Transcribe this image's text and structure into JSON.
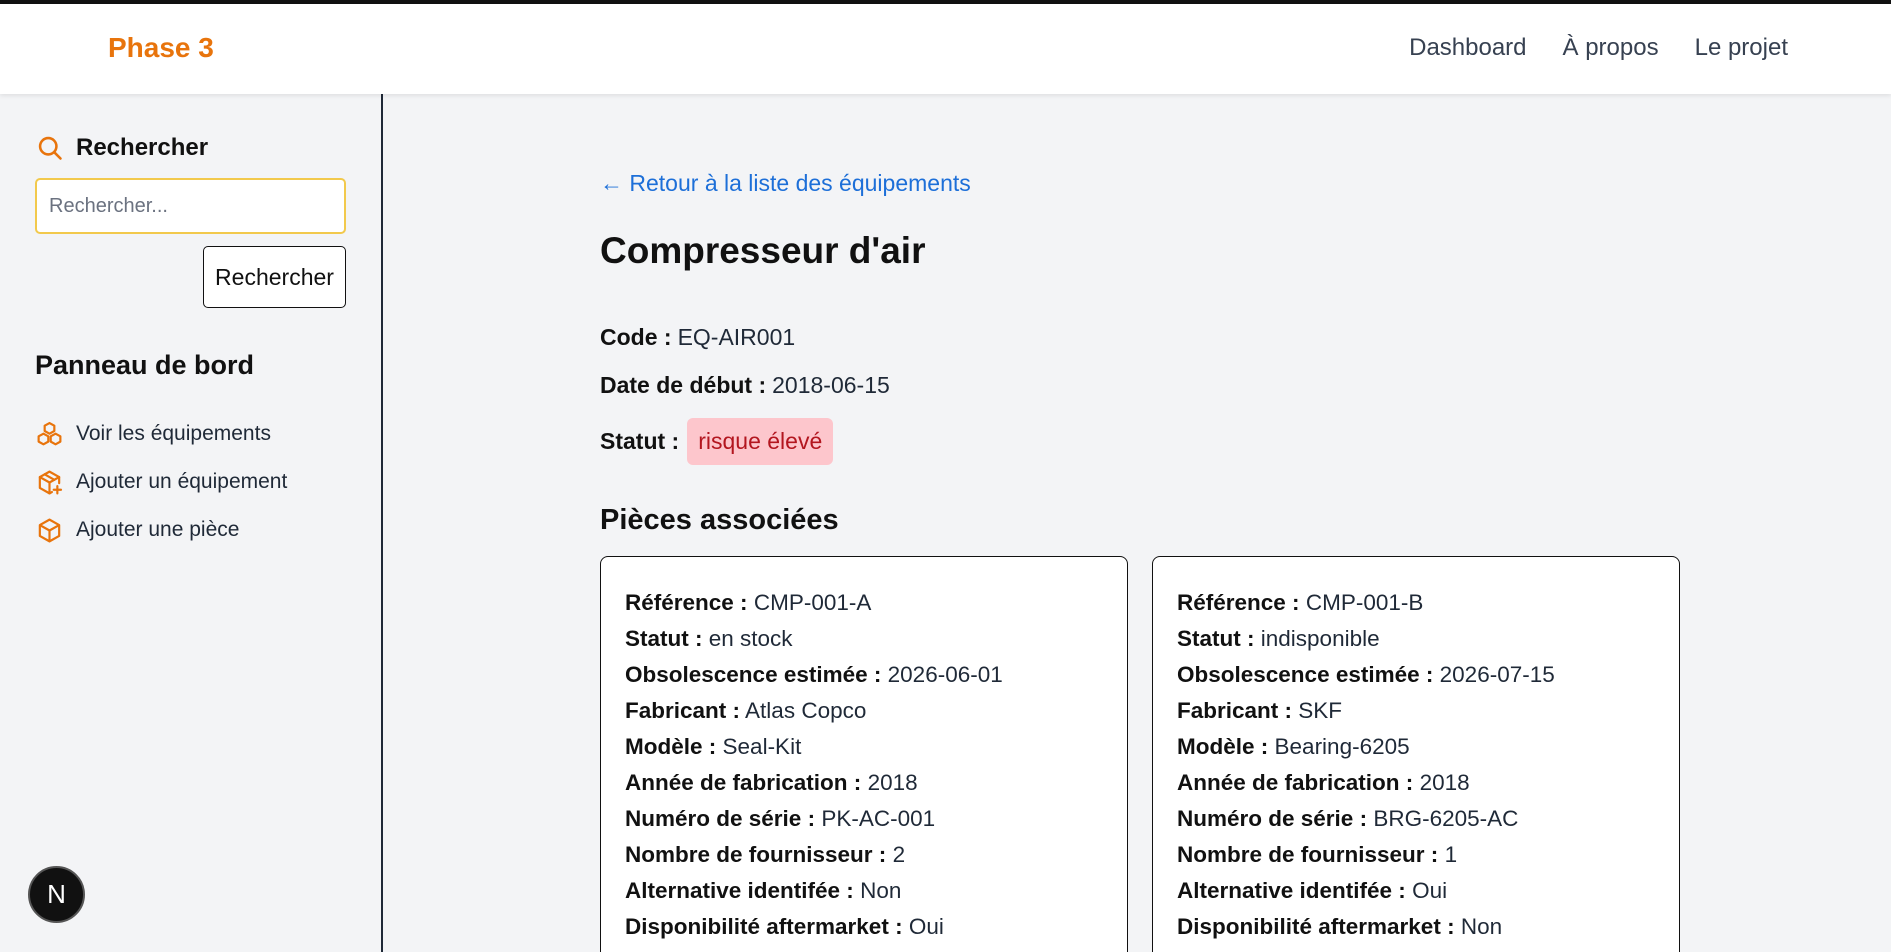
{
  "header": {
    "brand": "Phase 3",
    "nav": [
      "Dashboard",
      "À propos",
      "Le projet"
    ]
  },
  "sidebar": {
    "search_title": "Rechercher",
    "search_placeholder": "Rechercher...",
    "search_button": "Rechercher",
    "panel_title": "Panneau de bord",
    "items": [
      {
        "label": "Voir les équipements",
        "icon": "boxes-icon"
      },
      {
        "label": "Ajouter un équipement",
        "icon": "package-plus-icon"
      },
      {
        "label": "Ajouter une pièce",
        "icon": "box-icon"
      }
    ]
  },
  "main": {
    "back_link": "← Retour à la liste des équipements",
    "title": "Compresseur d'air",
    "code_label": "Code :",
    "code_value": "EQ-AIR001",
    "date_label": "Date de début :",
    "date_value": "2018-06-15",
    "status_label": "Statut :",
    "status_value": "risque élevé",
    "parts_title": "Pièces associées",
    "parts": [
      {
        "rows": [
          {
            "label": "Référence :",
            "value": "CMP-001-A"
          },
          {
            "label": "Statut :",
            "value": "en stock"
          },
          {
            "label": "Obsolescence estimée :",
            "value": "2026-06-01"
          },
          {
            "label": "Fabricant :",
            "value": "Atlas Copco"
          },
          {
            "label": "Modèle :",
            "value": "Seal-Kit"
          },
          {
            "label": "Année de fabrication :",
            "value": "2018"
          },
          {
            "label": "Numéro de série :",
            "value": "PK-AC-001"
          },
          {
            "label": "Nombre de fournisseur :",
            "value": "2"
          },
          {
            "label": "Alternative identifée :",
            "value": "Non"
          },
          {
            "label": "Disponibilité aftermarket :",
            "value": "Oui"
          }
        ]
      },
      {
        "rows": [
          {
            "label": "Référence :",
            "value": "CMP-001-B"
          },
          {
            "label": "Statut :",
            "value": "indisponible"
          },
          {
            "label": "Obsolescence estimée :",
            "value": "2026-07-15"
          },
          {
            "label": "Fabricant :",
            "value": "SKF"
          },
          {
            "label": "Modèle :",
            "value": "Bearing-6205"
          },
          {
            "label": "Année de fabrication :",
            "value": "2018"
          },
          {
            "label": "Numéro de série :",
            "value": "BRG-6205-AC"
          },
          {
            "label": "Nombre de fournisseur :",
            "value": "1"
          },
          {
            "label": "Alternative identifée :",
            "value": "Oui"
          },
          {
            "label": "Disponibilité aftermarket :",
            "value": "Non"
          }
        ]
      }
    ]
  },
  "dev_badge": "N",
  "colors": {
    "brand": "#e8740c",
    "link": "#1d6fd8",
    "status_bg": "#fdc6cc",
    "status_text": "#b3161f",
    "search_border": "#f2c94c"
  }
}
